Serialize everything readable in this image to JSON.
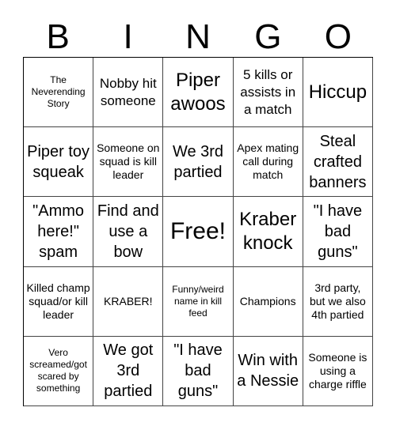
{
  "header": {
    "letters": [
      "B",
      "I",
      "N",
      "G",
      "O"
    ]
  },
  "cells": [
    {
      "text": "The Neverending Story",
      "size": "s1"
    },
    {
      "text": "Nobby hit someone",
      "size": "s3"
    },
    {
      "text": "Piper awoos",
      "size": "s5"
    },
    {
      "text": "5 kills or assists in a match",
      "size": "s3"
    },
    {
      "text": "Hiccup",
      "size": "s5"
    },
    {
      "text": "Piper toy squeak",
      "size": "s4"
    },
    {
      "text": "Someone on squad is kill leader",
      "size": "s2"
    },
    {
      "text": "We 3rd partied",
      "size": "s4"
    },
    {
      "text": "Apex mating call during match",
      "size": "s2"
    },
    {
      "text": "Steal crafted banners",
      "size": "s4"
    },
    {
      "text": "\"Ammo here!\" spam",
      "size": "s4"
    },
    {
      "text": "Find and use a bow",
      "size": "s4"
    },
    {
      "text": "Free!",
      "size": "s6"
    },
    {
      "text": "Kraber knock",
      "size": "s5"
    },
    {
      "text": "\"I have bad guns\"",
      "size": "s4"
    },
    {
      "text": "Killed champ squad/or kill leader",
      "size": "s2"
    },
    {
      "text": "KRABER!",
      "size": "s2"
    },
    {
      "text": "Funny/weird name in kill feed",
      "size": "s1"
    },
    {
      "text": "Champions",
      "size": "s2"
    },
    {
      "text": "3rd party, but we also 4th partied",
      "size": "s2"
    },
    {
      "text": "Vero screamed/got scared by something",
      "size": "s1"
    },
    {
      "text": "We got 3rd partied",
      "size": "s4"
    },
    {
      "text": "\"I have bad guns\"",
      "size": "s4"
    },
    {
      "text": "Win with a Nessie",
      "size": "s4"
    },
    {
      "text": "Someone is using a charge riffle",
      "size": "s2"
    }
  ]
}
